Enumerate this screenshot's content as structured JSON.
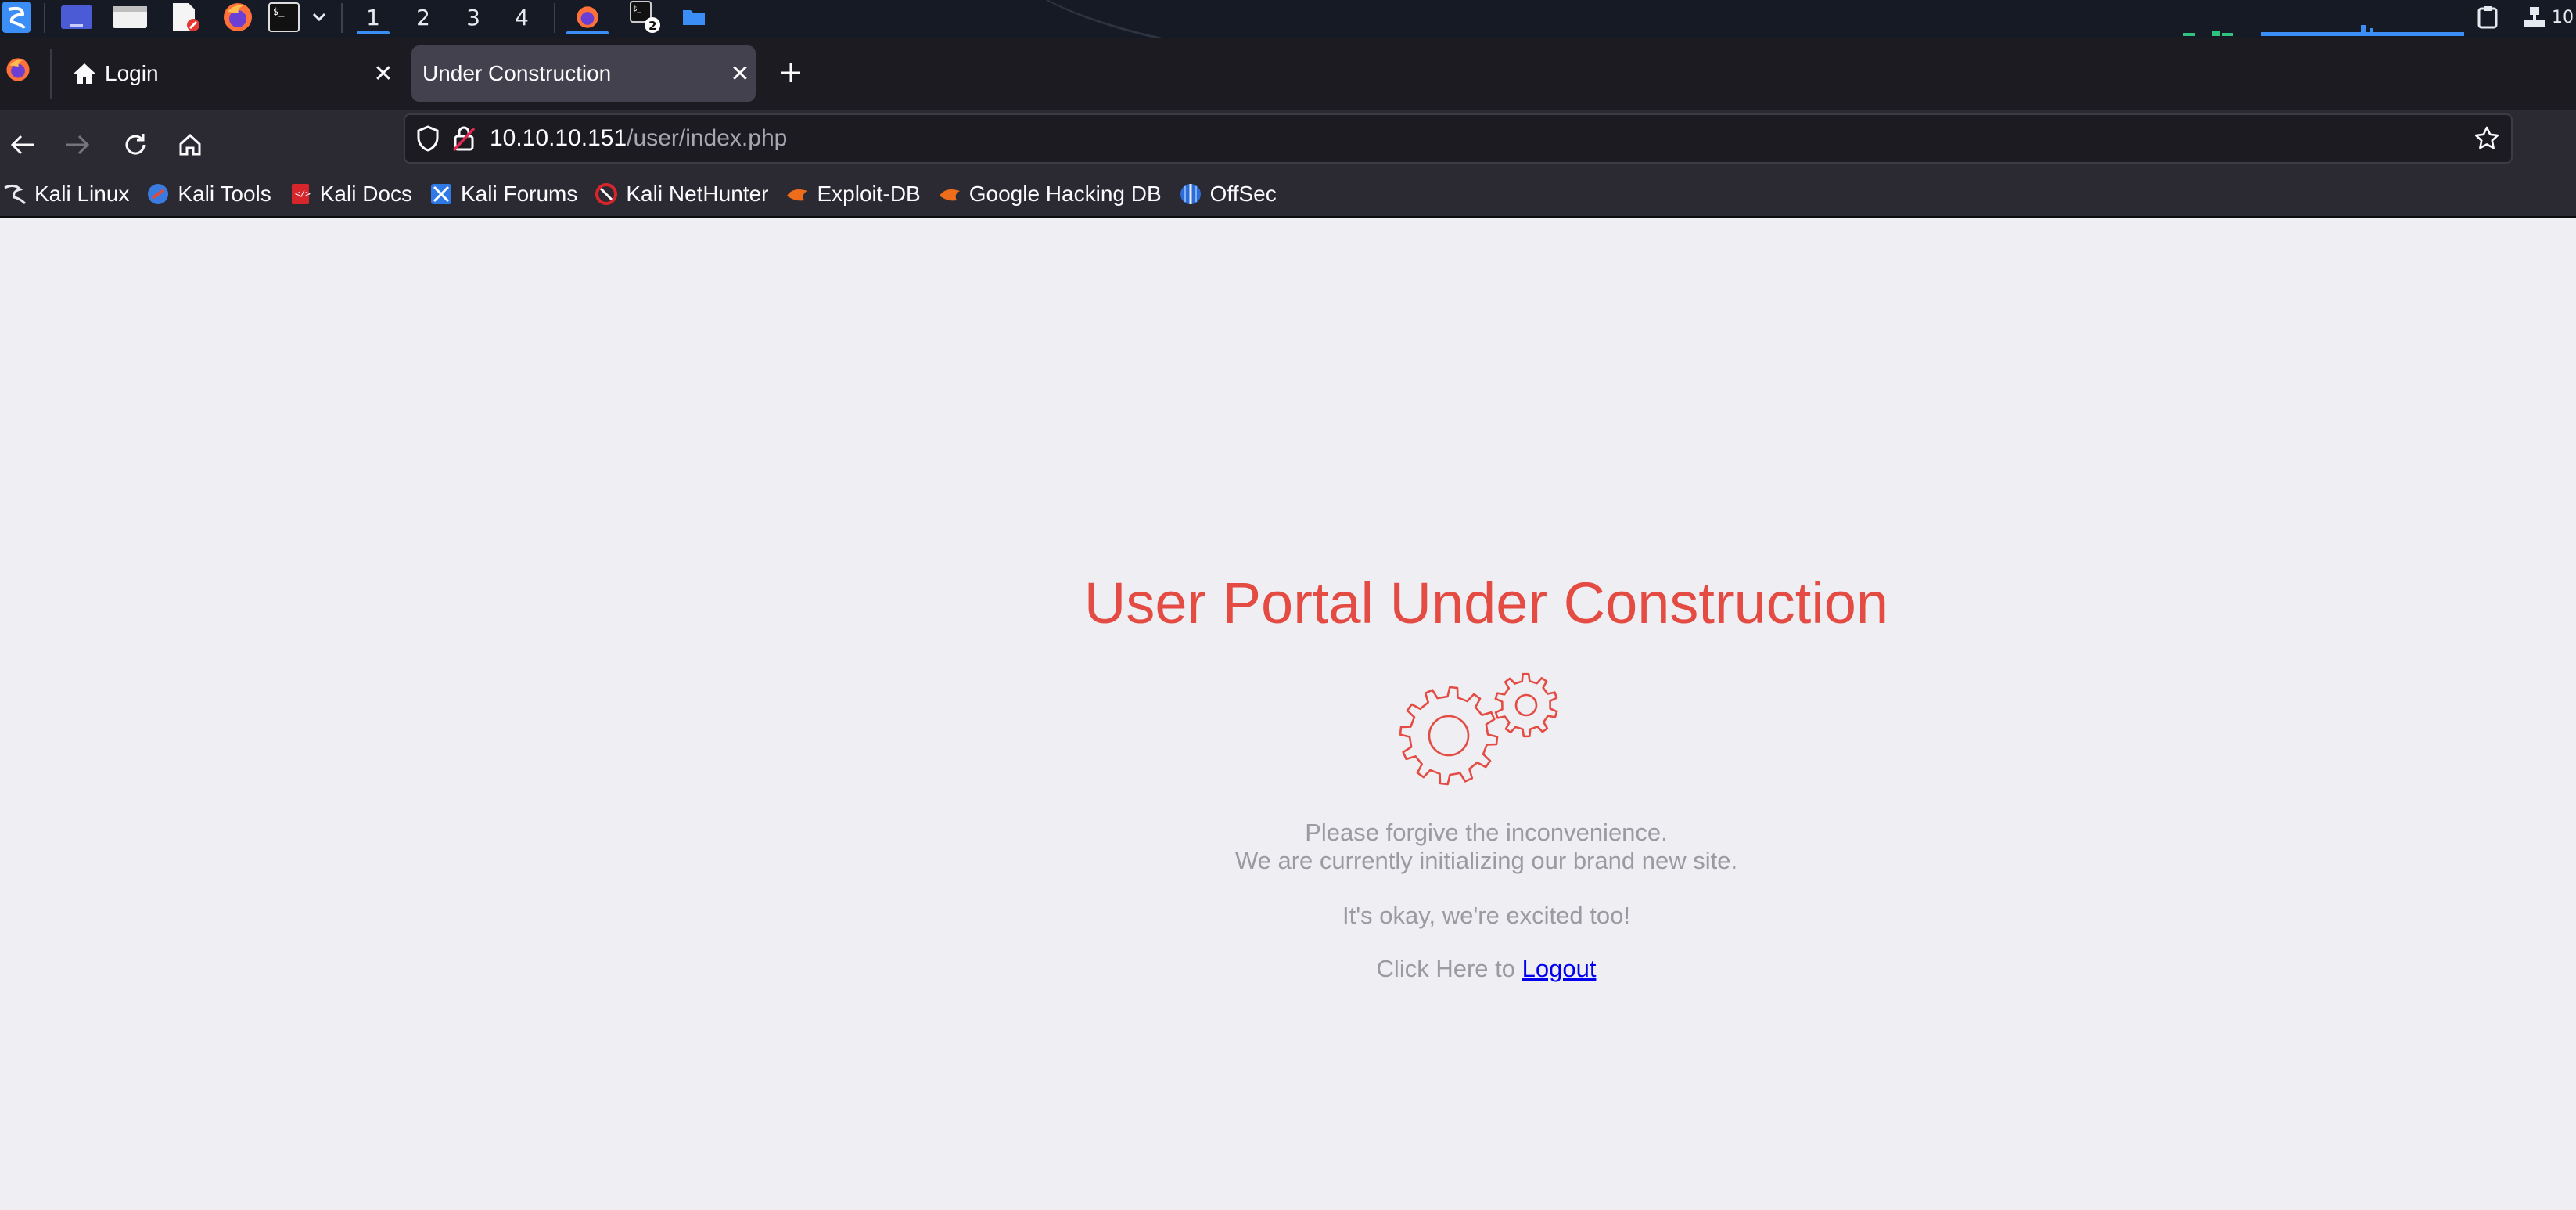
{
  "taskbar": {
    "workspaces": [
      "1",
      "2",
      "3",
      "4"
    ],
    "terminal_badge": "2",
    "clock_partial": "10"
  },
  "browser": {
    "tabs": [
      {
        "label": "Login",
        "active": false
      },
      {
        "label": "Under Construction",
        "active": true
      }
    ],
    "url": {
      "host": "10.10.10.151",
      "path": "/user/index.php"
    },
    "bookmarks": [
      {
        "label": "Kali Linux",
        "icon": "kali-dragon-icon"
      },
      {
        "label": "Kali Tools",
        "icon": "kali-tools-icon"
      },
      {
        "label": "Kali Docs",
        "icon": "kali-docs-icon"
      },
      {
        "label": "Kali Forums",
        "icon": "kali-forums-icon"
      },
      {
        "label": "Kali NetHunter",
        "icon": "nethunter-icon"
      },
      {
        "label": "Exploit-DB",
        "icon": "exploit-db-icon"
      },
      {
        "label": "Google Hacking DB",
        "icon": "ghdb-icon"
      },
      {
        "label": "OffSec",
        "icon": "offsec-icon"
      }
    ]
  },
  "page": {
    "title": "User Portal Under Construction",
    "line1": "Please forgive the inconvenience.",
    "line2": "We are currently initializing our brand new site.",
    "line3": "It's okay, we're excited too!",
    "logout_prefix": "Click Here to",
    "logout_link": "Logout"
  },
  "colors": {
    "accent_red": "#e34b43",
    "link_blue": "#0000ee",
    "page_bg": "#efeef3"
  }
}
